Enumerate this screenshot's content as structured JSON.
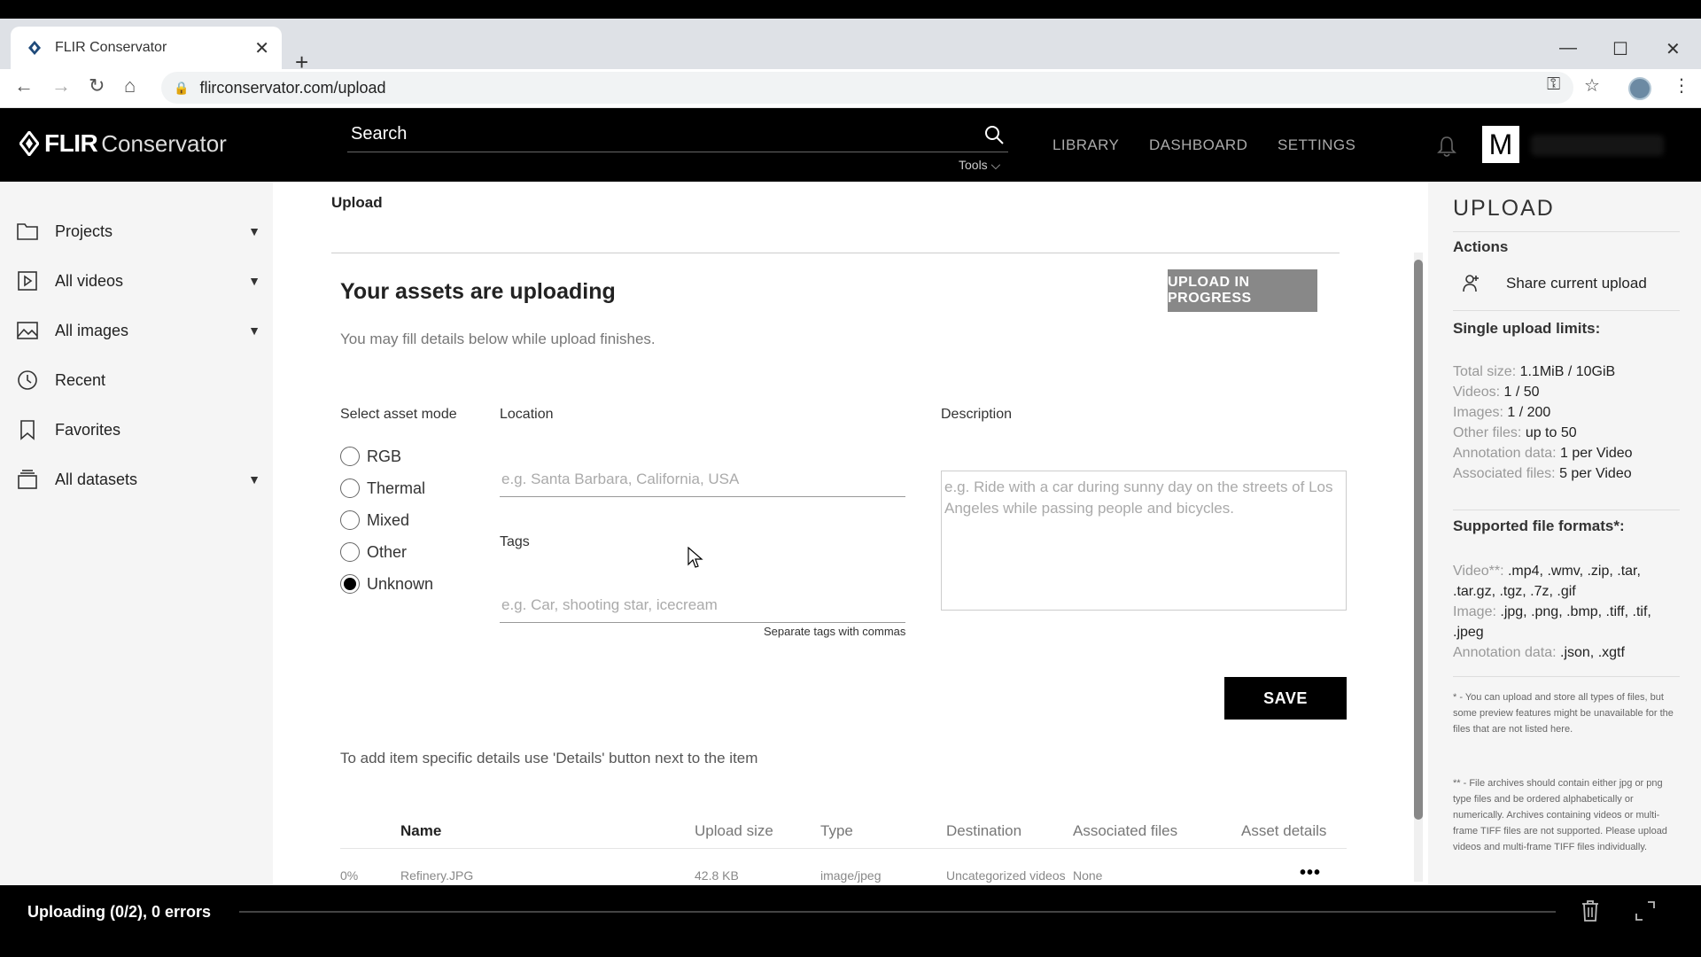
{
  "browser": {
    "tab_title": "FLIR Conservator",
    "new_tab": "+",
    "tab_close": "✕",
    "url": "flirconservator.com/upload",
    "controls": {
      "minimize": "—",
      "maximize": "☐",
      "close": "✕"
    }
  },
  "header": {
    "brand_bold": "FLIR",
    "brand_light": "Conservator",
    "search_placeholder": "Search",
    "tools_label": "Tools",
    "nav": {
      "library": "LIBRARY",
      "dashboard": "DASHBOARD",
      "settings": "SETTINGS"
    },
    "avatar_initial": "M"
  },
  "sidebar": {
    "items": [
      {
        "label": "Projects",
        "icon": "folder-icon",
        "expandable": true
      },
      {
        "label": "All videos",
        "icon": "video-icon",
        "expandable": true
      },
      {
        "label": "All images",
        "icon": "image-icon",
        "expandable": true
      },
      {
        "label": "Recent",
        "icon": "clock-icon",
        "expandable": false
      },
      {
        "label": "Favorites",
        "icon": "bookmark-icon",
        "expandable": false
      },
      {
        "label": "All datasets",
        "icon": "dataset-icon",
        "expandable": true
      }
    ]
  },
  "main": {
    "breadcrumb": "Upload",
    "heading": "Your assets are uploading",
    "status_button": "UPLOAD IN PROGRESS",
    "subheading": "You may fill details below while upload finishes.",
    "asset_mode_label": "Select asset mode",
    "asset_modes": [
      "RGB",
      "Thermal",
      "Mixed",
      "Other",
      "Unknown"
    ],
    "asset_mode_selected": "Unknown",
    "location_label": "Location",
    "location_placeholder": "e.g. Santa Barbara, California, USA",
    "tags_label": "Tags",
    "tags_placeholder": "e.g. Car, shooting star, icecream",
    "tags_hint": "Separate tags with commas",
    "description_label": "Description",
    "description_placeholder": "e.g. Ride with a car during sunny day on the streets of Los Angeles while passing people and bicycles.",
    "save_label": "SAVE",
    "details_info": "To add item specific details use 'Details' button next to the item",
    "table": {
      "headers": [
        "Name",
        "Upload size",
        "Type",
        "Destination",
        "Associated files",
        "Asset details"
      ],
      "rows": [
        {
          "progress": "0%",
          "name": "Refinery.JPG",
          "size": "42.8 KB",
          "type": "image/jpeg",
          "destination": "Uncategorized videos",
          "associated": "None",
          "details": "•••"
        }
      ]
    }
  },
  "panel": {
    "title": "UPLOAD",
    "actions_label": "Actions",
    "share_label": "Share current upload",
    "limits_title": "Single upload limits:",
    "limits": [
      {
        "k": "Total size:",
        "v": "1.1MiB / 10GiB"
      },
      {
        "k": "Videos:",
        "v": "1 / 50"
      },
      {
        "k": "Images:",
        "v": "1 / 200"
      },
      {
        "k": "Other files:",
        "v": "up to 50"
      },
      {
        "k": "Annotation data:",
        "v": "1 per Video"
      },
      {
        "k": "Associated files:",
        "v": "5 per Video"
      }
    ],
    "formats_title": "Supported file formats*:",
    "formats": [
      {
        "k": "Video**:",
        "v": ".mp4, .wmv, .zip, .tar, .tar.gz, .tgz, .7z, .gif"
      },
      {
        "k": "Image:",
        "v": ".jpg, .png, .bmp, .tiff, .tif, .jpeg"
      },
      {
        "k": "Annotation data:",
        "v": ".json, .xgtf"
      }
    ],
    "note1": "* - You can upload and store all types of files, but some preview features might be unavailable for the files that are not listed here.",
    "note2": "** - File archives should contain either jpg or png type files and be ordered alphabetically or numerically. Archives containing videos or multi-frame TIFF files are not supported. Please upload videos and multi-frame TIFF files individually."
  },
  "statusbar": {
    "text": "Uploading (0/2), 0 errors",
    "progress": 0
  }
}
